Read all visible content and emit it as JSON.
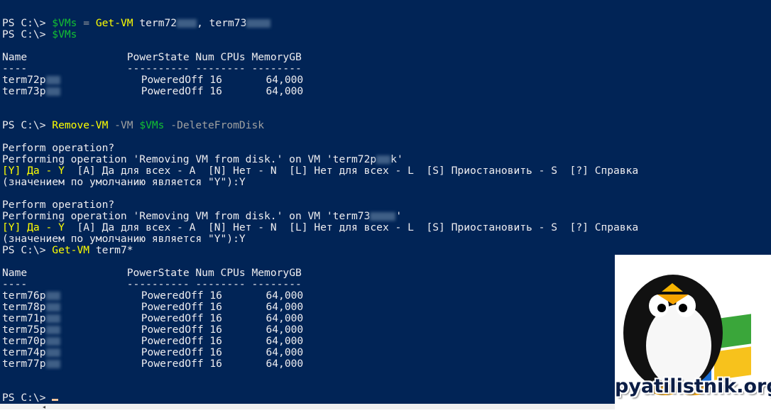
{
  "prompt": "PS C:\\> ",
  "cmd1": {
    "var": "$VMs",
    "op": "=",
    "cmdlet": "Get-VM",
    "arg1": "term72",
    "arg2": "term73"
  },
  "cmd2": {
    "var": "$VMs"
  },
  "table1": {
    "headers": [
      "Name",
      "PowerState Num CPUs MemoryGB"
    ],
    "underline_name": "----",
    "underline_rest": "---------- -------- --------",
    "rows": [
      {
        "name": "term72p",
        "rest": "PoweredOff 16       64,000"
      },
      {
        "name": "term73p",
        "rest": "PoweredOff 16       64,000"
      }
    ]
  },
  "cmd3": {
    "cmdlet": "Remove-VM",
    "param1": "-VM",
    "var": "$VMs",
    "param2": "-DeleteFromDisk"
  },
  "confirm1": {
    "q": "Perform operation?",
    "op_prefix": "Performing operation 'Removing VM from disk.' on VM 'term72p",
    "op_suffix": "k'",
    "choices_yes": "[Y] Да - Y",
    "choices_rest": "  [A] Да для всех - A  [N] Нет - N  [L] Нет для всех - L  [S] Приостановить - S  [?] Справка",
    "default": "(значением по умолчанию является \"Y\"):Y"
  },
  "confirm2": {
    "q": "Perform operation?",
    "op_prefix": "Performing operation 'Removing VM from disk.' on VM 'term73",
    "op_suffix": "'",
    "choices_yes": "[Y] Да - Y",
    "choices_rest": "  [A] Да для всех - A  [N] Нет - N  [L] Нет для всех - L  [S] Приостановить - S  [?] Справка",
    "default": "(значением по умолчанию является \"Y\"):Y"
  },
  "cmd4": {
    "cmdlet": "Get-VM",
    "arg": "term7*"
  },
  "table2": {
    "rows": [
      {
        "name": "term76p",
        "rest": "PoweredOff 16       64,000"
      },
      {
        "name": "term78p",
        "rest": "PoweredOff 16       64,000"
      },
      {
        "name": "term71p",
        "rest": "PoweredOff 16       64,000"
      },
      {
        "name": "term75p",
        "rest": "PoweredOff 16       64,000"
      },
      {
        "name": "term70p",
        "rest": "PoweredOff 16       64,000"
      },
      {
        "name": "term74p",
        "rest": "PoweredOff 16       64,000"
      },
      {
        "name": "term77p",
        "rest": "PoweredOff 16       64,000"
      }
    ]
  },
  "logo": {
    "text": "pyatilistnik.org"
  },
  "colors": {
    "background": "#012456",
    "cmdlet": "#ffff00",
    "variable": "#13bf32",
    "parameter": "#a0a0a0",
    "text": "#eeedf0"
  }
}
